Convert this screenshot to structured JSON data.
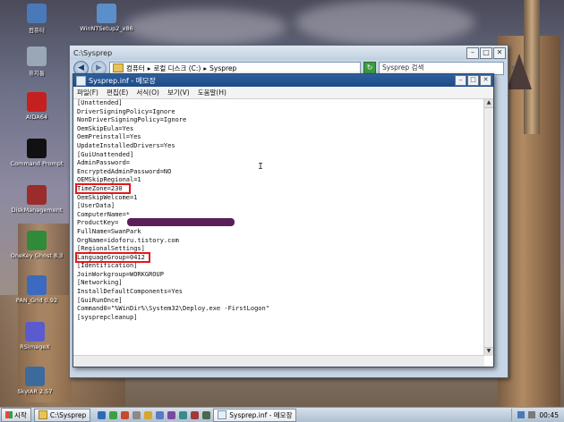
{
  "desktop_icons": [
    {
      "label": "컴퓨터",
      "icon": "computer-icon",
      "color": "#4a79b8"
    },
    {
      "label": "휴지통",
      "icon": "recycle-bin-icon",
      "color": "#9aa7b6"
    },
    {
      "label": "AIDA64",
      "icon": "aida64-icon",
      "color": "#c42020"
    },
    {
      "label": "Command Prompt",
      "icon": "command-prompt-icon",
      "color": "#111111"
    },
    {
      "label": "DiskManagement",
      "icon": "disk-management-icon",
      "color": "#9a2c2c"
    },
    {
      "label": "OneKey Ghost 8.3",
      "icon": "onekey-ghost-icon",
      "color": "#2f8a3a"
    },
    {
      "label": "PAN_Grid 0.92",
      "icon": "pan-grid-icon",
      "color": "#3b6ac0"
    },
    {
      "label": "RSImageX",
      "icon": "rsimagex-icon",
      "color": "#5b5bd0"
    },
    {
      "label": "SkyIAR 2.57",
      "icon": "skyiar-icon",
      "color": "#3d6a9c"
    },
    {
      "label": "WinNTSetup2_x86",
      "icon": "winntsetup-icon",
      "color": "#5c8fc9"
    }
  ],
  "explorer": {
    "title": "C:\\Sysprep",
    "breadcrumb": [
      "컴퓨터",
      "로컬 디스크 (C:)",
      "Sysprep"
    ],
    "search_placeholder": "Sysprep 검색"
  },
  "notepad": {
    "title": "Sysprep.inf - 메모장",
    "menu": [
      "파일(F)",
      "편집(E)",
      "서식(O)",
      "보기(V)",
      "도움말(H)"
    ],
    "lines": [
      "[Unattended]",
      "DriverSigningPolicy=Ignore",
      "NonDriverSigningPolicy=Ignore",
      "OemSkipEula=Yes",
      "OemPreinstall=Yes",
      "UpdateInstalledDrivers=Yes",
      "[GuiUnattended]",
      "AdminPassword=",
      "EncryptedAdminPassword=NO",
      "OEMSkipRegional=1",
      "TimeZone=230",
      "OemSkipWelcome=1",
      "[UserData]",
      "ComputerName=*",
      "ProductKey=",
      "FullName=SwanPark",
      "OrgName=idoforu.tistory.com",
      "[RegionalSettings]",
      "LanguageGroup=0412",
      "[Identification]",
      "JoinWorkgroup=WORKGROUP",
      "[Networking]",
      "InstallDefaultComponents=Yes",
      "[GuiRunOnce]",
      "Command0=\"%WinDir%\\System32\\Deploy.exe -FirstLogon\"",
      "[sysprepcleanup]"
    ]
  },
  "taskbar": {
    "start_label": "시작",
    "items": [
      {
        "label": "C:\\Sysprep",
        "active": false
      },
      {
        "label": "Sysprep.inf - 메모장",
        "active": true
      }
    ],
    "clock": "00:45"
  },
  "colors": {
    "highlight": "#e4171b",
    "redaction": "#5c1e5a",
    "notepad_title": "#1e4b86"
  }
}
